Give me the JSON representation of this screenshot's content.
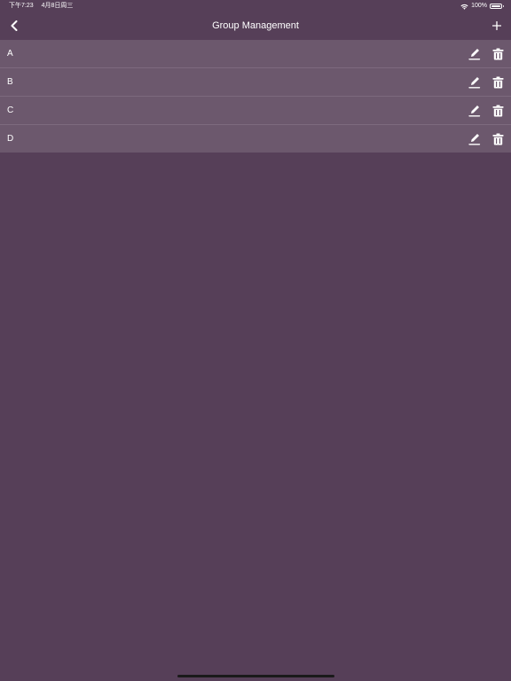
{
  "status_bar": {
    "time": "下午7:23",
    "date": "4月8日周三",
    "battery_percent": "100%",
    "battery_level": 1.0
  },
  "nav": {
    "title": "Group Management",
    "back_icon": "chevron-left-icon",
    "add_icon": "plus-icon"
  },
  "groups": [
    {
      "name": "A"
    },
    {
      "name": "B"
    },
    {
      "name": "C"
    },
    {
      "name": "D"
    }
  ],
  "colors": {
    "background": "#563f58",
    "row_background": "#6c586d",
    "row_divider": "#7d6a7e",
    "text": "#ffffff"
  }
}
